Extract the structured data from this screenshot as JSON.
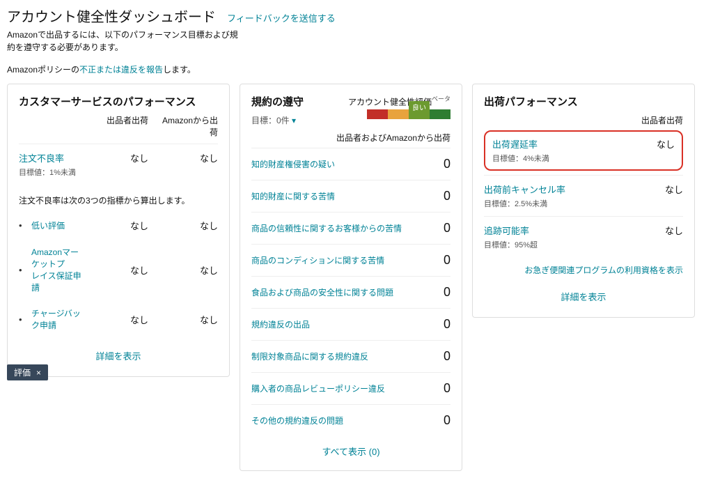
{
  "header": {
    "title": "アカウント健全性ダッシュボード",
    "feedback_link": "フィードバックを送信する",
    "subtext": "Amazonで出品するには、以下のパフォーマンス目標および規約を遵守する必要があります。",
    "policy_prefix": "Amazonポリシーの",
    "policy_link": "不正または違反を報告",
    "policy_suffix": "します。"
  },
  "cs": {
    "title": "カスタマーサービスのパフォーマンス",
    "col1": "出品者出荷",
    "col2": "Amazonから出荷",
    "odr": {
      "label": "注文不良率",
      "target": "目標値：1%未満",
      "v1": "なし",
      "v2": "なし"
    },
    "note": "注文不良率は次の3つの指標から算出します。",
    "items": [
      {
        "label": "低い評価",
        "v1": "なし",
        "v2": "なし"
      },
      {
        "label": "Amazonマーケットプ\nレイス保証申請",
        "v1": "なし",
        "v2": "なし"
      },
      {
        "label": "チャージバック申請",
        "v1": "なし",
        "v2": "なし"
      }
    ],
    "details": "詳細を表示"
  },
  "comp": {
    "title": "規約の遵守",
    "ahr_label": "アカウント健全性評価",
    "ahr_beta": "ベータ",
    "target": "目標：0件",
    "good": "良い",
    "ship_header": "出品者およびAmazonから出荷",
    "items": [
      {
        "label": "知的財産権侵害の疑い",
        "value": "0"
      },
      {
        "label": "知的財産に関する苦情",
        "value": "0"
      },
      {
        "label": "商品の信頼性に関するお客様からの苦情",
        "value": "0"
      },
      {
        "label": "商品のコンディションに関する苦情",
        "value": "0"
      },
      {
        "label": "食品および商品の安全性に関する問題",
        "value": "0"
      },
      {
        "label": "規約違反の出品",
        "value": "0"
      },
      {
        "label": "制限対象商品に関する規約違反",
        "value": "0"
      },
      {
        "label": "購入者の商品レビューポリシー違反",
        "value": "0"
      },
      {
        "label": "その他の規約違反の問題",
        "value": "0"
      }
    ],
    "show_all": "すべて表示 (0)"
  },
  "ship": {
    "title": "出荷パフォーマンス",
    "col": "出品者出荷",
    "rows": [
      {
        "label": "出荷遅延率",
        "target": "目標値：4%未満",
        "value": "なし",
        "highlight": true
      },
      {
        "label": "出荷前キャンセル率",
        "target": "目標値：2.5%未満",
        "value": "なし"
      },
      {
        "label": "追跡可能率",
        "target": "目標値：95%超",
        "value": "なし"
      }
    ],
    "elig_link": "お急ぎ便関連プログラムの利用資格を表示",
    "details": "詳細を表示"
  },
  "footer": {
    "label": "評価",
    "close": "×"
  }
}
